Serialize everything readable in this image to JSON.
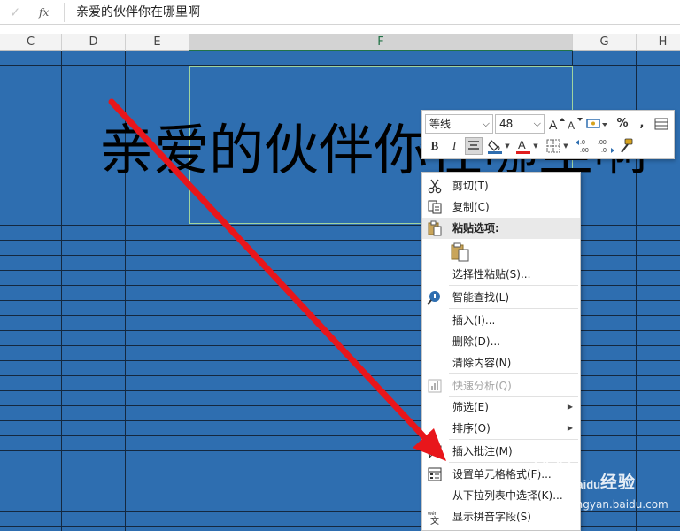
{
  "formula_bar": {
    "check_icon": "check-icon",
    "fx_label": "fx",
    "content": "亲爱的伙伴你在哪里啊"
  },
  "columns": [
    {
      "label": "C"
    },
    {
      "label": "D"
    },
    {
      "label": "E"
    },
    {
      "label": "F",
      "selected": true
    },
    {
      "label": "G"
    },
    {
      "label": "H"
    }
  ],
  "cell": {
    "text": "亲爱的伙伴你在哪里啊"
  },
  "colors": {
    "cell_fill": "#2e6eb0",
    "grid_lines": "#14283f",
    "selection_border": "#9fd49f",
    "arrow": "#e8161b",
    "font_color_accent": "#e01e1e"
  },
  "mini_toolbar": {
    "font_name": "等线",
    "font_size": "48",
    "bold": "B",
    "italic": "I",
    "percent": "%",
    "comma": ","
  },
  "context_menu": {
    "items": [
      {
        "label": "剪切(T)",
        "icon": "scissors-icon"
      },
      {
        "label": "复制(C)",
        "icon": "copy-icon"
      },
      {
        "label": "粘贴选项:",
        "icon": "paste-icon",
        "header": true
      },
      {
        "label": "",
        "icon": "paste-option-icon"
      },
      {
        "label": "选择性粘贴(S)..."
      },
      {
        "label": "智能查找(L)",
        "icon": "smart-lookup-icon"
      },
      {
        "label": "插入(I)..."
      },
      {
        "label": "删除(D)..."
      },
      {
        "label": "清除内容(N)"
      },
      {
        "label": "快速分析(Q)",
        "icon": "quick-analysis-icon",
        "disabled": true
      },
      {
        "label": "筛选(E)",
        "submenu": true
      },
      {
        "label": "排序(O)",
        "submenu": true
      },
      {
        "label": "插入批注(M)",
        "icon": "comment-icon"
      },
      {
        "label": "设置单元格格式(F)...",
        "icon": "format-cells-icon"
      },
      {
        "label": "从下拉列表中选择(K)..."
      },
      {
        "label": "显示拼音字段(S)",
        "icon": "phonetic-icon"
      }
    ]
  },
  "watermark": {
    "brand": "经验",
    "url": "jingyan.baidu.com",
    "logo_text": "Baidu"
  }
}
